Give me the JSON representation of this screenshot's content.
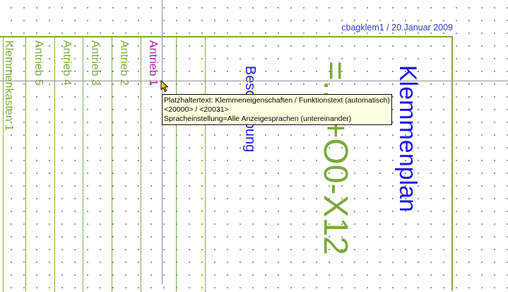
{
  "header": {
    "text": "cbagklem1 / 20.Januar 2009"
  },
  "columns": [
    {
      "label": "Klemmenkasten 1",
      "color": "#7aa83a"
    },
    {
      "label": "Antrieb 5",
      "color": "#7aa83a"
    },
    {
      "label": "Antrieb 4",
      "color": "#7aa83a"
    },
    {
      "label": "Antrieb 3",
      "color": "#7aa83a"
    },
    {
      "label": "Antrieb 2",
      "color": "#7aa83a"
    },
    {
      "label": "Antrieb 1",
      "color": "#b213b2"
    }
  ],
  "beschreibung": "Beschreibung",
  "designation": "=..0+O0-X12",
  "title": "Klemmenplan",
  "tooltip": {
    "line1": "Platzhaltertext: Klemmeneigenschaften / Funktionstext (automatisch)",
    "line2": "<20000> / <20031>",
    "line3": "Spracheinstellung=Alle Anzeigesprachen (untereinander)"
  },
  "cursor": {
    "icon": "arrow-pointer-icon"
  },
  "colors": {
    "frame": "#7aa83a",
    "title_blue": "#1a14e6",
    "highlight": "#b213b2"
  }
}
